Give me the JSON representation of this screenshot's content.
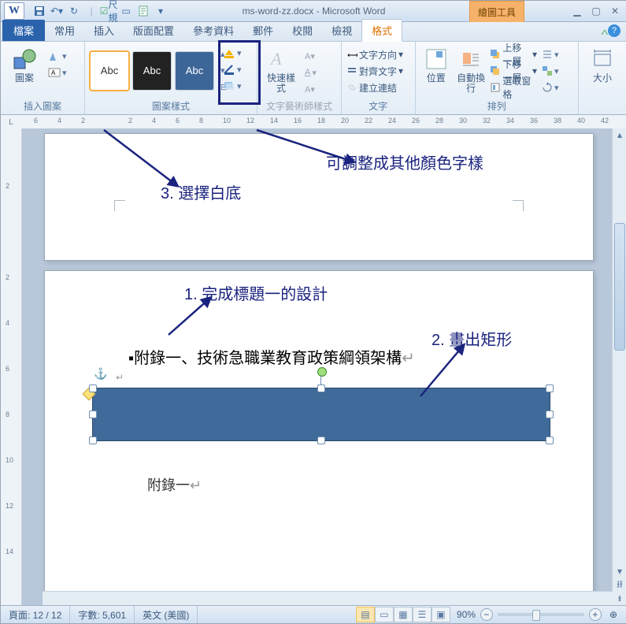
{
  "titlebar": {
    "app_initial": "W",
    "ruler_toggle_label": "尺規",
    "doc_title": "ms-word-zz.docx - Microsoft Word",
    "context_tab": "繪圖工具"
  },
  "tabs": {
    "file": "檔案",
    "list": [
      "常用",
      "插入",
      "版面配置",
      "參考資料",
      "郵件",
      "校閱",
      "檢視"
    ],
    "active": "格式"
  },
  "ribbon": {
    "insert_shapes": {
      "big": "圖案",
      "label": "插入圖案"
    },
    "shape_styles": {
      "big": "Abc",
      "label": "圖案樣式"
    },
    "wordart": {
      "quick": "快速樣式",
      "label": "文字藝術師樣式"
    },
    "text": {
      "dir": "文字方向",
      "align": "對齊文字",
      "link": "建立連結",
      "label": "文字"
    },
    "arrange": {
      "pos": "位置",
      "wrap": "自動換行",
      "r1": "上移一層",
      "r2": "下移一層",
      "r3": "選取窗格",
      "label": "排列"
    },
    "size": {
      "label": "大小"
    }
  },
  "document": {
    "heading1": "附錄一、技術急職業教育政策綱領架構",
    "body1": "附錄一"
  },
  "callouts": {
    "c1": "可調整成其他顏色字樣",
    "c2": "3. 選擇白底",
    "c3": "1. 完成標題一的設計",
    "c4": "2. 畫出矩形"
  },
  "status": {
    "page": "頁面: 12 / 12",
    "words": "字數: 5,601",
    "lang": "英文 (美國)",
    "zoom": "90%"
  },
  "ruler_nums_h": [
    "6",
    "4",
    "2",
    "",
    "2",
    "4",
    "6",
    "8",
    "10",
    "12",
    "14",
    "16",
    "18",
    "20",
    "22",
    "24",
    "26",
    "28",
    "30",
    "32",
    "34",
    "36",
    "38",
    "40",
    "42"
  ],
  "ruler_nums_v": [
    "",
    "2",
    "",
    "2",
    "4",
    "6",
    "8",
    "10",
    "12",
    "14"
  ]
}
